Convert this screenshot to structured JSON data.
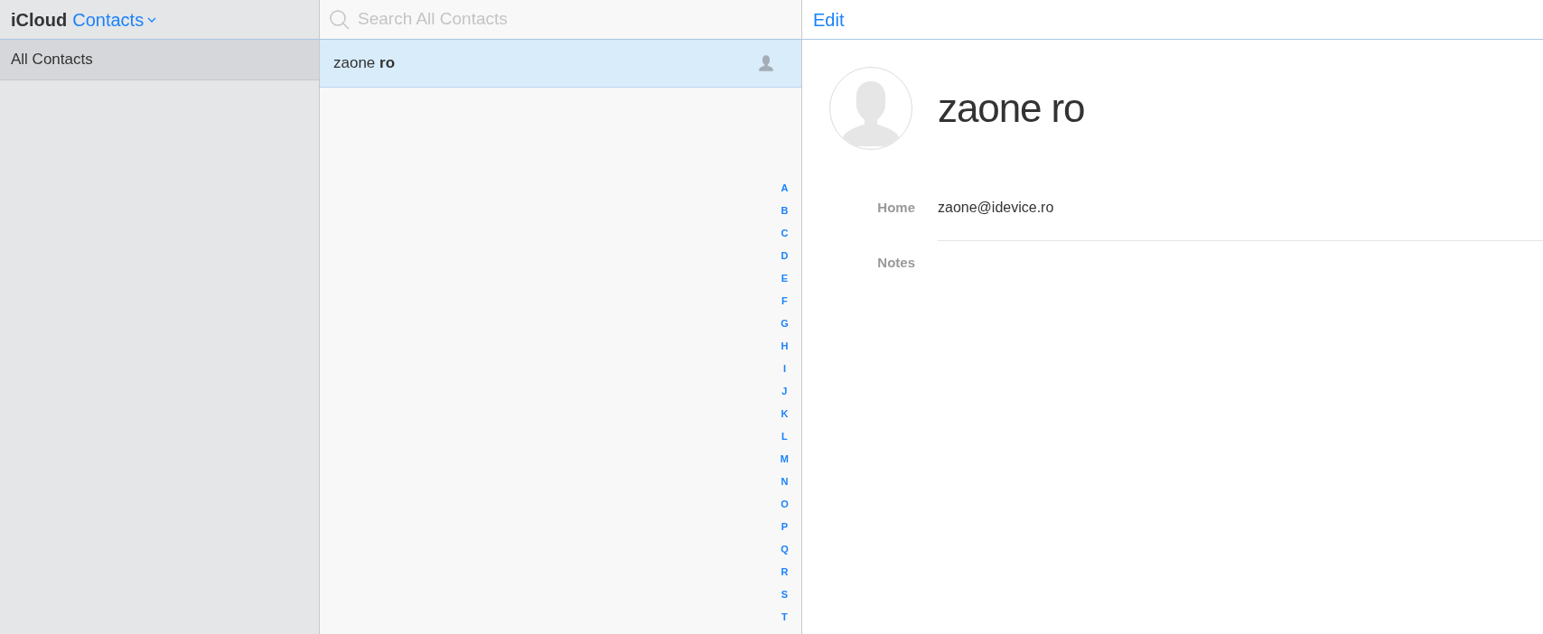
{
  "header": {
    "brand": "iCloud",
    "app": "Contacts"
  },
  "sidebar": {
    "items": [
      {
        "label": "All Contacts",
        "selected": true
      }
    ]
  },
  "search": {
    "placeholder": "Search All Contacts"
  },
  "contacts": [
    {
      "name": "zaone **ro**",
      "selected": true
    }
  ],
  "index": [
    "A",
    "B",
    "C",
    "D",
    "E",
    "F",
    "G",
    "H",
    "I",
    "J",
    "K",
    "L",
    "M",
    "N",
    "O",
    "P",
    "Q",
    "R",
    "S",
    "T"
  ],
  "detail": {
    "edit": "Edit",
    "name": "zaone ro",
    "fields": [
      {
        "label": "Home",
        "value": "zaone@idevice.ro",
        "kind": "value"
      },
      {
        "label": "Notes",
        "kind": "notes"
      }
    ]
  }
}
